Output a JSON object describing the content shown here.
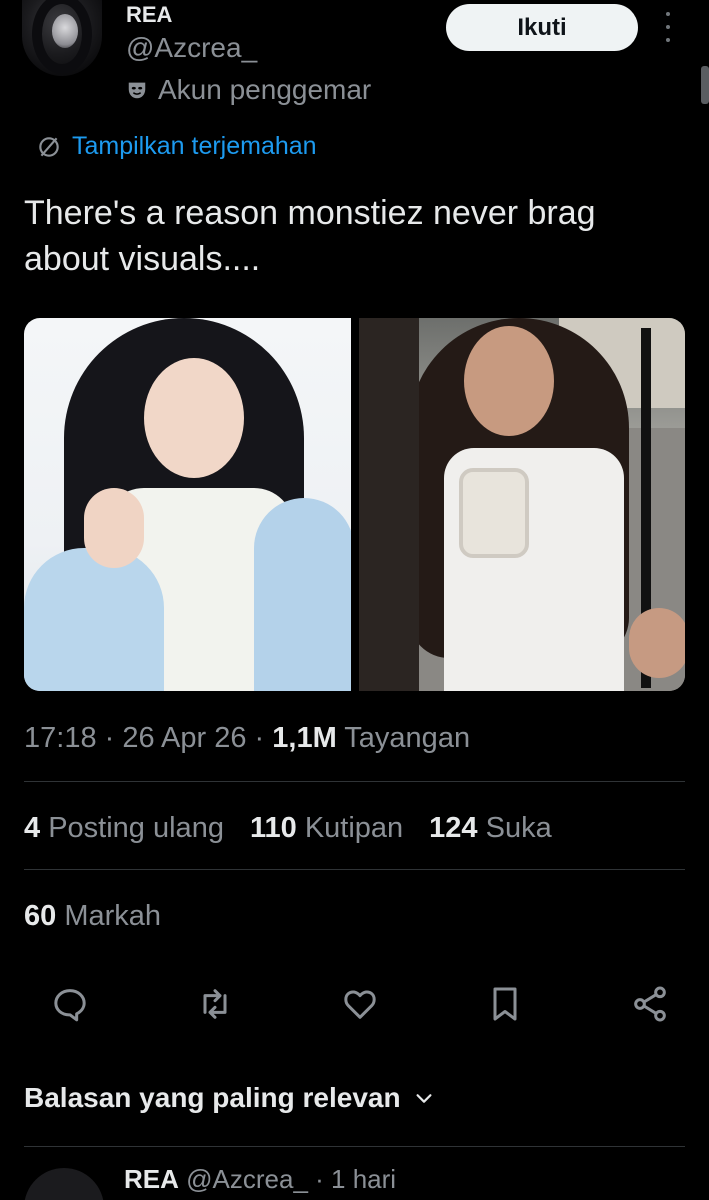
{
  "author": {
    "name": "REA",
    "handle": "@Azcrea_",
    "label": "Akun penggemar"
  },
  "header": {
    "follow_label": "Ikuti"
  },
  "translate_label": "Tampilkan terjemahan",
  "tweet_text": "There's a reason monstiez never brag about visuals....",
  "meta": {
    "time": "17:18 · 26 Apr 26 · ",
    "views_count": "1,1M",
    "views_label": " Tayangan"
  },
  "stats": {
    "reposts_count": "4",
    "reposts_label": "Posting ulang",
    "quotes_count": "110",
    "quotes_label": "Kutipan",
    "likes_count": "124",
    "likes_label": "Suka",
    "bookmarks_count": "60",
    "bookmarks_label": "Markah"
  },
  "replies_sort_label": "Balasan yang paling relevan",
  "next_reply": {
    "name": "REA",
    "handle": "@Azcrea_",
    "time": "1 hari"
  },
  "icons": [
    "more-icon",
    "fan-mask-icon",
    "translate-icon",
    "reply-icon",
    "repost-icon",
    "like-icon",
    "bookmark-icon",
    "share-icon",
    "chevron-down-icon"
  ],
  "colors": {
    "background": "#000000",
    "text": "#e7e9ea",
    "muted": "#8b9096",
    "link": "#1d9bf0",
    "follow_bg": "#eff3f4"
  }
}
